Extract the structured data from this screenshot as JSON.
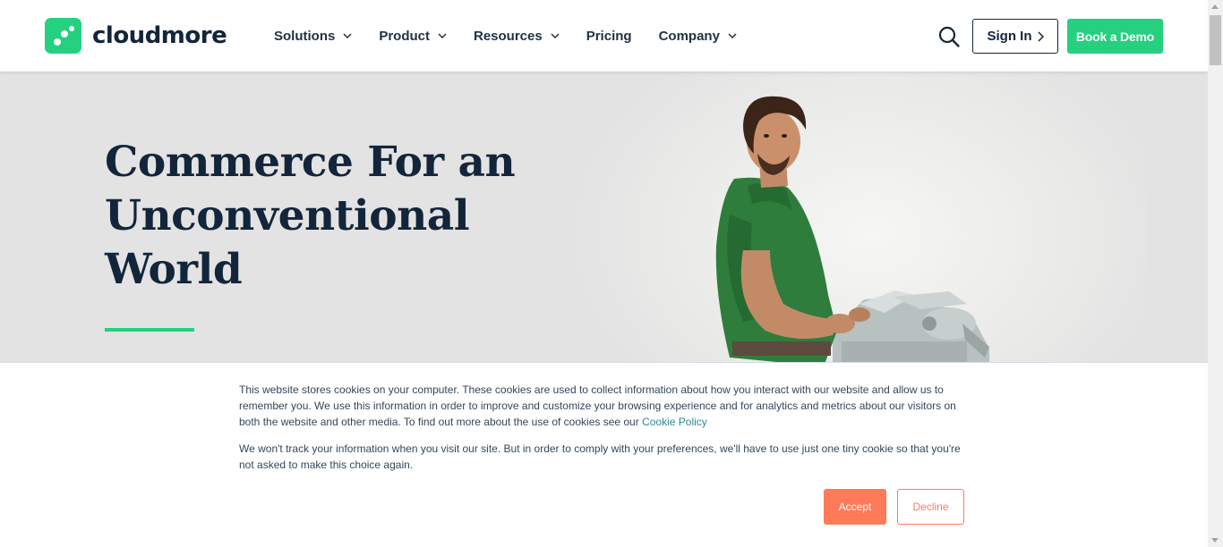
{
  "header": {
    "logo_text": "cloudmore",
    "nav": [
      {
        "label": "Solutions",
        "has_dropdown": true
      },
      {
        "label": "Product",
        "has_dropdown": true
      },
      {
        "label": "Resources",
        "has_dropdown": true
      },
      {
        "label": "Pricing",
        "has_dropdown": false
      },
      {
        "label": "Company",
        "has_dropdown": true
      }
    ],
    "search_icon": "search-icon",
    "signin_label": "Sign In",
    "demo_label": "Book a Demo"
  },
  "hero": {
    "title_lines": [
      "Commerce For an",
      "Unconventional",
      "World"
    ]
  },
  "cookie_banner": {
    "paragraph1": "This website stores cookies on your computer. These cookies are used to collect information about how you interact with our website and allow us to remember you. We use this information in order to improve and customize your browsing experience and for analytics and metrics about our visitors on both the website and other media. To find out more about the use of cookies see our",
    "policy_link": "Cookie Policy",
    "paragraph2": "We won't track your information when you visit our site. But in order to comply with your preferences, we'll have to use just one tiny cookie so that you're not asked to make this choice again.",
    "accept_label": "Accept",
    "decline_label": "Decline"
  },
  "colors": {
    "brand_green": "#25d07f",
    "navy": "#13253a",
    "cookie_accent": "#ff7a59",
    "hero_bg": "#e3e3e3"
  }
}
